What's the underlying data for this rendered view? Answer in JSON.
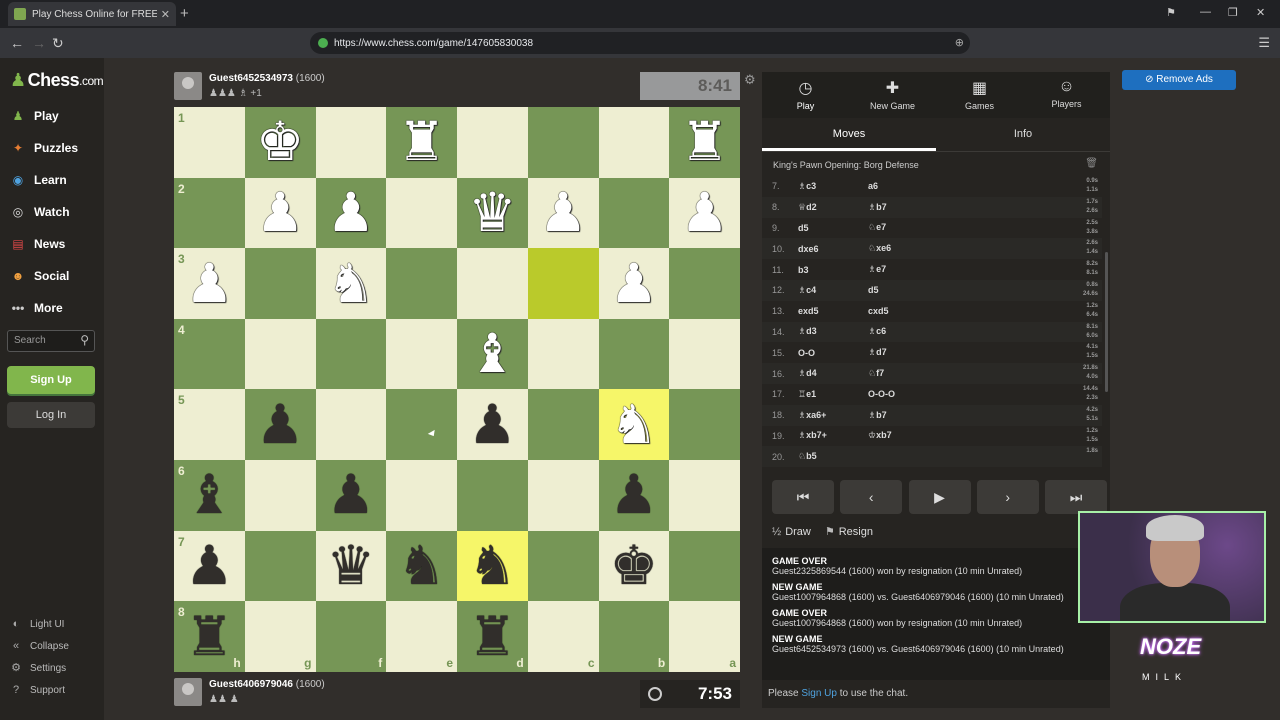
{
  "browser": {
    "tab_title": "Play Chess Online for FREE - C",
    "url": "https://www.chess.com/game/147605830038"
  },
  "sidebar": {
    "logo": "Chess",
    "logo_suffix": ".com",
    "nav": [
      {
        "label": "Play",
        "icon": "pawn-icon"
      },
      {
        "label": "Puzzles",
        "icon": "puzzle-icon"
      },
      {
        "label": "Learn",
        "icon": "learn-icon"
      },
      {
        "label": "Watch",
        "icon": "binoculars-icon"
      },
      {
        "label": "News",
        "icon": "news-icon"
      },
      {
        "label": "Social",
        "icon": "social-icon"
      },
      {
        "label": "More",
        "icon": "more-icon"
      }
    ],
    "search_placeholder": "Search",
    "signup_label": "Sign Up",
    "login_label": "Log In",
    "footer": [
      {
        "label": "Light UI",
        "icon": "lightbulb-icon"
      },
      {
        "label": "Collapse",
        "icon": "collapse-icon"
      },
      {
        "label": "Settings",
        "icon": "gear-icon"
      },
      {
        "label": "Support",
        "icon": "help-icon"
      }
    ]
  },
  "top_player": {
    "name": "Guest6452534973",
    "rating": "(1600)",
    "captured": "♟♟♟ ♗ +1",
    "clock": "8:41"
  },
  "bottom_player": {
    "name": "Guest6406979046",
    "rating": "(1600)",
    "captured": "♟♟ ♟",
    "clock": "7:53"
  },
  "board": {
    "rank_labels": [
      "1",
      "2",
      "3",
      "4",
      "5",
      "6",
      "7",
      "8"
    ],
    "file_labels": [
      "h",
      "g",
      "f",
      "e",
      "d",
      "c",
      "b",
      "a"
    ],
    "rows": [
      [
        "",
        "wK",
        "",
        "wR",
        "",
        "",
        "",
        "wR"
      ],
      [
        "",
        "wP",
        "wP",
        "",
        "wQ",
        "wP",
        "",
        "wP"
      ],
      [
        "wP",
        "",
        "wN",
        "",
        "",
        "",
        "wP",
        ""
      ],
      [
        "",
        "",
        "",
        "",
        "wB",
        "",
        "",
        ""
      ],
      [
        "",
        "bP",
        "",
        "",
        "bP",
        "",
        "wN",
        ""
      ],
      [
        "bB",
        "",
        "bP",
        "",
        "",
        "",
        "bP",
        ""
      ],
      [
        "bP",
        "",
        "bQ",
        "bN",
        "bN",
        "",
        "bK",
        ""
      ],
      [
        "bR",
        "",
        "",
        "",
        "bR",
        "",
        "",
        ""
      ]
    ],
    "highlights": {
      "2-5": true,
      "4-6": true,
      "6-4": true
    }
  },
  "panel": {
    "tabs": [
      {
        "label": "Play",
        "icon": "stopwatch-icon"
      },
      {
        "label": "New Game",
        "icon": "plus-icon"
      },
      {
        "label": "Games",
        "icon": "grid-icon"
      },
      {
        "label": "Players",
        "icon": "players-icon"
      }
    ],
    "subtabs": [
      "Moves",
      "Info"
    ],
    "opening": "King's Pawn Opening: Borg Defense",
    "moves": [
      {
        "n": "7.",
        "w": "♗c3",
        "b": "a6",
        "t1": "0.9s",
        "t2": "1.1s"
      },
      {
        "n": "8.",
        "w": "♕d2",
        "b": "♗b7",
        "t1": "1.7s",
        "t2": "2.6s"
      },
      {
        "n": "9.",
        "w": "d5",
        "b": "♘e7",
        "t1": "2.5s",
        "t2": "3.8s"
      },
      {
        "n": "10.",
        "w": "dxe6",
        "b": "♘xe6",
        "t1": "2.6s",
        "t2": "1.4s"
      },
      {
        "n": "11.",
        "w": "b3",
        "b": "♗e7",
        "t1": "8.2s",
        "t2": "8.1s"
      },
      {
        "n": "12.",
        "w": "♗c4",
        "b": "d5",
        "t1": "0.8s",
        "t2": "24.6s"
      },
      {
        "n": "13.",
        "w": "exd5",
        "b": "cxd5",
        "t1": "1.2s",
        "t2": "6.4s"
      },
      {
        "n": "14.",
        "w": "♗d3",
        "b": "♗c6",
        "t1": "8.1s",
        "t2": "6.0s"
      },
      {
        "n": "15.",
        "w": "O-O",
        "b": "♗d7",
        "t1": "4.1s",
        "t2": "1.5s"
      },
      {
        "n": "16.",
        "w": "♗d4",
        "b": "♘f7",
        "t1": "21.8s",
        "t2": "4.0s"
      },
      {
        "n": "17.",
        "w": "♖e1",
        "b": "O-O-O",
        "t1": "14.4s",
        "t2": "2.3s"
      },
      {
        "n": "18.",
        "w": "♗xa6+",
        "b": "♗b7",
        "t1": "4.2s",
        "t2": "5.1s"
      },
      {
        "n": "19.",
        "w": "♗xb7+",
        "b": "♔xb7",
        "t1": "1.2s",
        "t2": "1.5s"
      },
      {
        "n": "20.",
        "w": "♘b5",
        "b": "",
        "t1": "1.8s",
        "t2": ""
      }
    ],
    "controls": [
      "⏮",
      "‹",
      "▶",
      "›",
      "⏭"
    ],
    "draw_label": "Draw",
    "resign_label": "Resign",
    "log": [
      {
        "head": "GAME OVER",
        "text": "Guest2325869544 (1600) won by resignation (10 min Unrated)"
      },
      {
        "head": "NEW GAME",
        "text": "Guest1007964868 (1600) vs. Guest6406979046 (1600) (10 min Unrated)"
      },
      {
        "head": "GAME OVER",
        "text": "Guest1007964868 (1600) won by resignation (10 min Unrated)"
      },
      {
        "head": "NEW GAME",
        "text": "Guest6452534973 (1600) vs. Guest6406979046 (1600) (10 min Unrated)"
      }
    ],
    "chat_prefix": "Please",
    "chat_link": "Sign Up",
    "chat_suffix": "to use the chat."
  },
  "remove_ads_label": "Remove Ads",
  "overlay": {
    "big": "NOZE",
    "small": "MILK"
  },
  "colors": {
    "light_square": "#eeeed2",
    "dark_square": "#769656",
    "accent_green": "#81b64c",
    "highlight": "#f6f669"
  }
}
